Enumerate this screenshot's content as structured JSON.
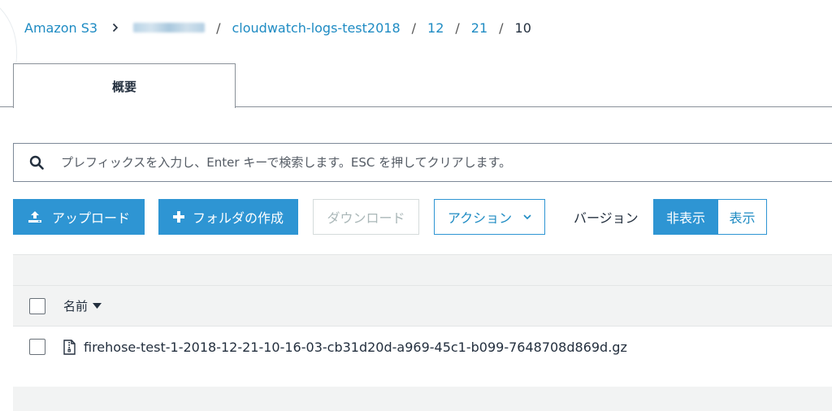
{
  "breadcrumb": {
    "root": "Amazon S3",
    "bucket": "cloudwatch-logs-test2018",
    "path1": "12",
    "path2": "21",
    "current": "10",
    "separator": "/",
    "chevron": ">"
  },
  "tabs": {
    "overview": "概要"
  },
  "search": {
    "placeholder": "プレフィックスを入力し、Enter キーで検索します。ESC を押してクリアします。",
    "value": ""
  },
  "toolbar": {
    "upload": "アップロード",
    "create_folder": "フォルダの作成",
    "download": "ダウンロード",
    "actions": "アクション",
    "version_label": "バージョン",
    "version_hide": "非表示",
    "version_show": "表示"
  },
  "table": {
    "name_header": "名前",
    "rows": [
      {
        "name": "firehose-test-1-2018-12-21-10-16-03-cb31d20d-a969-45c1-b099-7648708d869d.gz"
      }
    ]
  },
  "colors": {
    "accent": "#2e95d3",
    "link": "#1e8bc3",
    "text": "#232f3e",
    "band": "#f2f3f3"
  },
  "icons": {
    "search": "search-icon",
    "upload": "upload-icon",
    "plus": "plus-icon",
    "chevron": "chevron-down-icon",
    "sort": "sort-caret-icon",
    "file": "file-zip-icon"
  }
}
